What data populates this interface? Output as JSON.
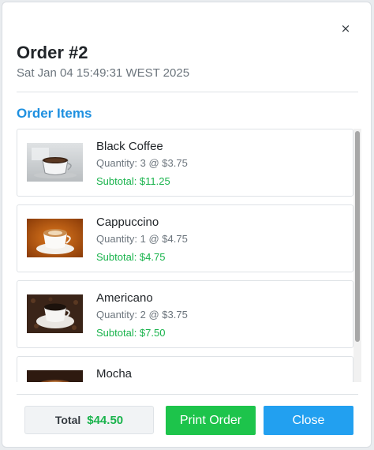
{
  "modal": {
    "close_symbol": "×",
    "title": "Order #2",
    "date": "Sat Jan 04 15:49:31 WEST 2025",
    "section_title": "Order Items"
  },
  "items": [
    {
      "name": "Black Coffee",
      "quantity": "Quantity: 3 @ $3.75",
      "subtotal": "Subtotal: $11.25",
      "image": "black-coffee-image"
    },
    {
      "name": "Cappuccino",
      "quantity": "Quantity: 1 @ $4.75",
      "subtotal": "Subtotal: $4.75",
      "image": "cappuccino-image"
    },
    {
      "name": "Americano",
      "quantity": "Quantity: 2 @ $3.75",
      "subtotal": "Subtotal: $7.50",
      "image": "americano-image"
    },
    {
      "name": "Mocha",
      "quantity": "",
      "subtotal": "",
      "image": "mocha-image"
    }
  ],
  "footer": {
    "total_label": "Total",
    "total_value": "$44.50",
    "print_label": "Print Order",
    "close_label": "Close"
  },
  "colors": {
    "accent": "#1e90e0",
    "price_green": "#19b34c",
    "print_button": "#1dc44b",
    "close_button": "#22a0f0"
  }
}
